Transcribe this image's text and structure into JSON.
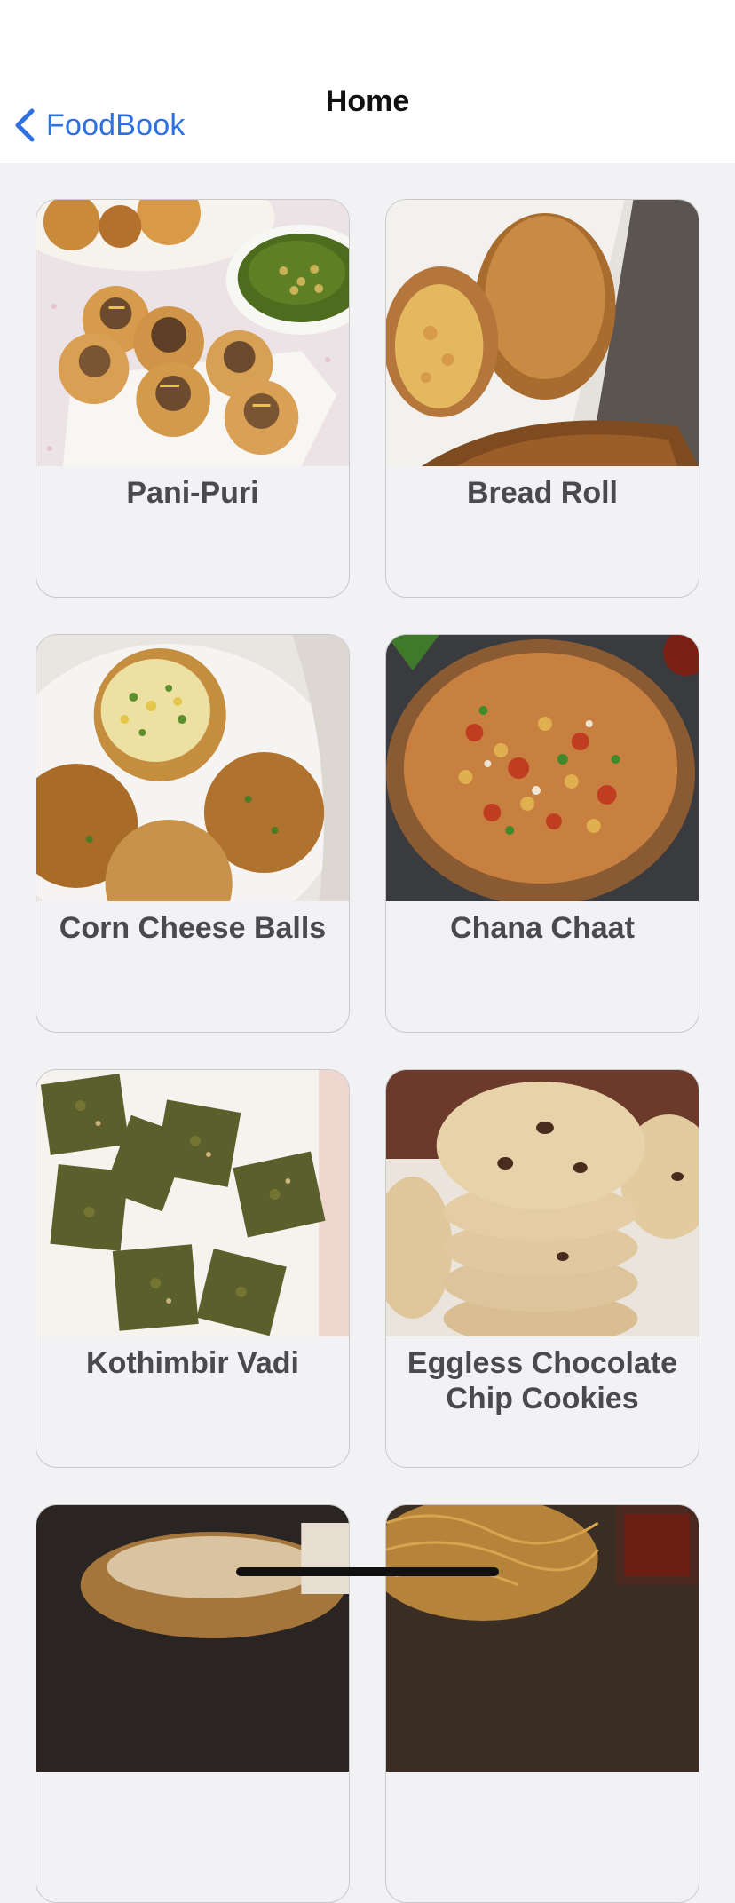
{
  "navbar": {
    "back_label": "FoodBook",
    "title": "Home"
  },
  "recipes": [
    {
      "title": "Pani-Puri",
      "image_icon": "pani-puri-photo"
    },
    {
      "title": "Bread Roll",
      "image_icon": "bread-roll-photo"
    },
    {
      "title": "Corn Cheese Balls",
      "image_icon": "corn-cheese-balls-photo"
    },
    {
      "title": "Chana Chaat",
      "image_icon": "chana-chaat-photo"
    },
    {
      "title": "Kothimbir Vadi",
      "image_icon": "kothimbir-vadi-photo"
    },
    {
      "title": "Eggless Chocolate Chip Cookies",
      "image_icon": "cookies-photo"
    },
    {
      "title": "",
      "image_icon": "sandwich-photo"
    },
    {
      "title": "",
      "image_icon": "noodles-photo"
    }
  ],
  "colors": {
    "accent": "#2f6fe0",
    "background": "#f2f2f4",
    "card_border": "#c9c9cc",
    "title_text": "#4a4a4c"
  }
}
